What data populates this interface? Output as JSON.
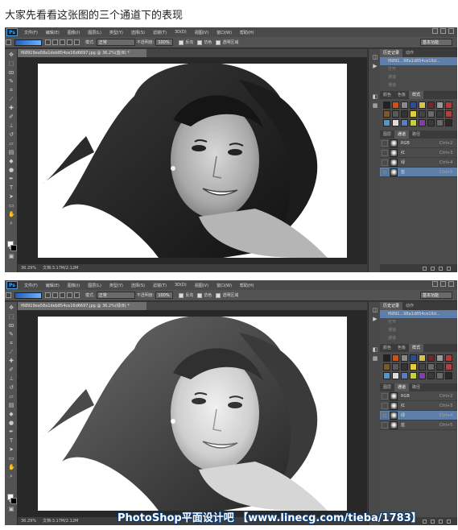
{
  "caption": "大家先看看这张图的三个通道下的表现",
  "logo": "Ps",
  "menu": [
    "文件(F)",
    "编辑(E)",
    "图像(I)",
    "图层(L)",
    "类型(Y)",
    "选择(S)",
    "滤镜(T)",
    "3D(D)",
    "视图(V)",
    "窗口(W)",
    "帮助(H)"
  ],
  "options": {
    "mode_label": "模式:",
    "mode_value": "正常",
    "opacity_label": "不透明度:",
    "opacity_value": "100%",
    "reverse": "反向",
    "dither": "仿色",
    "transparency": "透明区域",
    "workspace": "基本功能"
  },
  "panel": {
    "tabs": [
      "历史记录",
      "动作"
    ],
    "layer_tabs": [
      "颜色",
      "色板",
      "样式"
    ],
    "channel_tabs": [
      "图层",
      "通道",
      "路径"
    ]
  },
  "screens": [
    {
      "doc_tab": "f68919ea58a1deb854ce16d6697.jpg @ 36.2%(蓝/8) *",
      "zoom": "36.29%",
      "doc_info": "文档:3.17M/2.12M",
      "history_file": "f6891...98a1d854ce16d...",
      "history_items": [
        "打开",
        "通道",
        "通道"
      ],
      "channels": [
        {
          "name": "RGB",
          "key": "Ctrl+2"
        },
        {
          "name": "红",
          "key": "Ctrl+3"
        },
        {
          "name": "绿",
          "key": "Ctrl+4"
        },
        {
          "name": "蓝",
          "key": "Ctrl+5"
        }
      ],
      "selected_channel": "蓝"
    },
    {
      "doc_tab": "f68919ea58a1deb854ce16d6697.jpg @ 36.2%(绿/8) *",
      "zoom": "36.29%",
      "doc_info": "文档:3.17M/2.12M",
      "history_file": "f6891...98a1d854ce16d...",
      "history_items": [
        "打开",
        "通道",
        "通道"
      ],
      "channels": [
        {
          "name": "RGB",
          "key": "Ctrl+2"
        },
        {
          "name": "红",
          "key": "Ctrl+3"
        },
        {
          "name": "绿",
          "key": "Ctrl+4"
        },
        {
          "name": "蓝",
          "key": "Ctrl+5"
        }
      ],
      "selected_channel": "绿"
    }
  ],
  "watermark": "PhotoShop平面设计吧 【www.linecg.com/tieba/1783】",
  "colors": {
    "ps_dark": "#3a3a3a",
    "panel": "#4b4b4b",
    "selection": "#5e7fa9",
    "ps_blue": "#4aa2e8"
  }
}
